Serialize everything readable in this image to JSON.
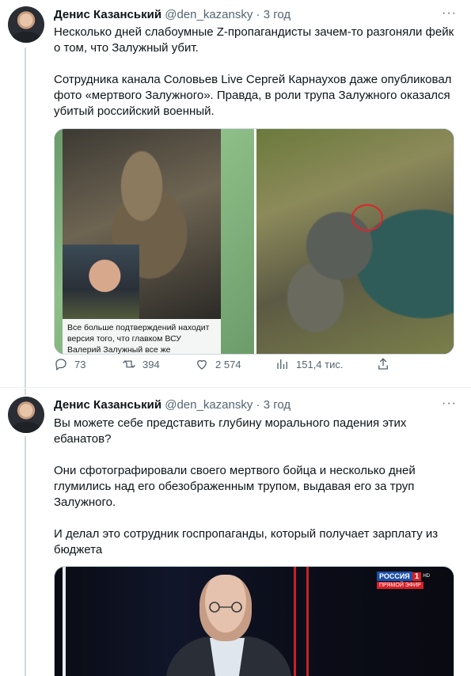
{
  "tweets": [
    {
      "author": {
        "name": "Денис Казанський",
        "handle": "@den_kazansky",
        "separator": "·",
        "time": "3 год"
      },
      "more_label": "···",
      "paragraphs": [
        "Несколько дней слабоумные Z-пропагандисты зачем-то разгоняли фейк о том, что Залужный убит.",
        "Сотрудника канала Соловьев Live Сергей Карнаухов даже опубликовал фото «мертвого Залужного». Правда, в роли трупа Залужного оказался убитый российский военный."
      ],
      "media_caption": "Все больше подтверждений находит версия того, что главком ВСУ Валерий Залужный все же",
      "actions": {
        "replies": "73",
        "retweets": "394",
        "likes": "2 574",
        "views": "151,4 тис."
      }
    },
    {
      "author": {
        "name": "Денис Казанський",
        "handle": "@den_kazansky",
        "separator": "·",
        "time": "3 год"
      },
      "more_label": "···",
      "paragraphs": [
        "Вы можете себе представить глубину морального падения этих ебанатов?",
        "Они сфотографировали своего мертвого бойца и несколько дней глумились над его обезображенным трупом, выдавая его за труп Залужного.",
        "И делал это сотрудник госпропаганды, который получает зарплату из бюджета"
      ],
      "tv_logo": {
        "channel": "РОССИЯ",
        "number": "1",
        "hd": "HD",
        "live": "ПРЯМОЙ ЭФИР"
      }
    }
  ],
  "colors": {
    "text": "#0f1419",
    "secondary": "#536471",
    "border": "#cfd9de",
    "highlight_circle": "#e0232a"
  }
}
